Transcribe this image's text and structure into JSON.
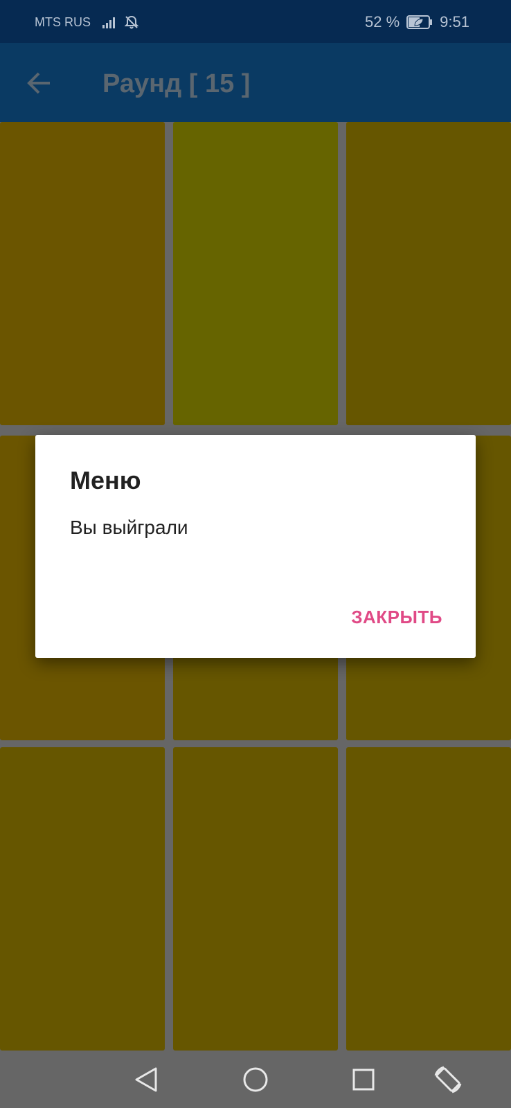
{
  "status_bar": {
    "carrier": "MTS RUS",
    "battery_percent": "52 %",
    "time": "9:51",
    "icons": [
      "signal-icon",
      "notifications-off-icon",
      "battery-saver-icon"
    ]
  },
  "app_bar": {
    "back_icon": "arrow-back-icon",
    "title": "Раунд [ 15 ]"
  },
  "grid": {
    "rows": 3,
    "columns": 3,
    "cells": [
      {
        "color": "#6b5500"
      },
      {
        "color": "#666400"
      },
      {
        "color": "#665600"
      },
      {
        "color": "#6b5500"
      },
      {
        "color": "#665600"
      },
      {
        "color": "#665600"
      },
      {
        "color": "#665600"
      },
      {
        "color": "#665600"
      },
      {
        "color": "#665600"
      }
    ]
  },
  "dialog": {
    "title": "Меню",
    "message": "Вы выйграли",
    "button_label": "ЗАКРЫТЬ",
    "accent_color": "#e04a86"
  },
  "nav_bar": {
    "icons": [
      "back-triangle-icon",
      "home-circle-icon",
      "recents-square-icon",
      "rotate-screen-icon"
    ]
  },
  "colors": {
    "status_bar": "#062a52",
    "app_bar": "#0a3a63",
    "background": "#666666"
  }
}
